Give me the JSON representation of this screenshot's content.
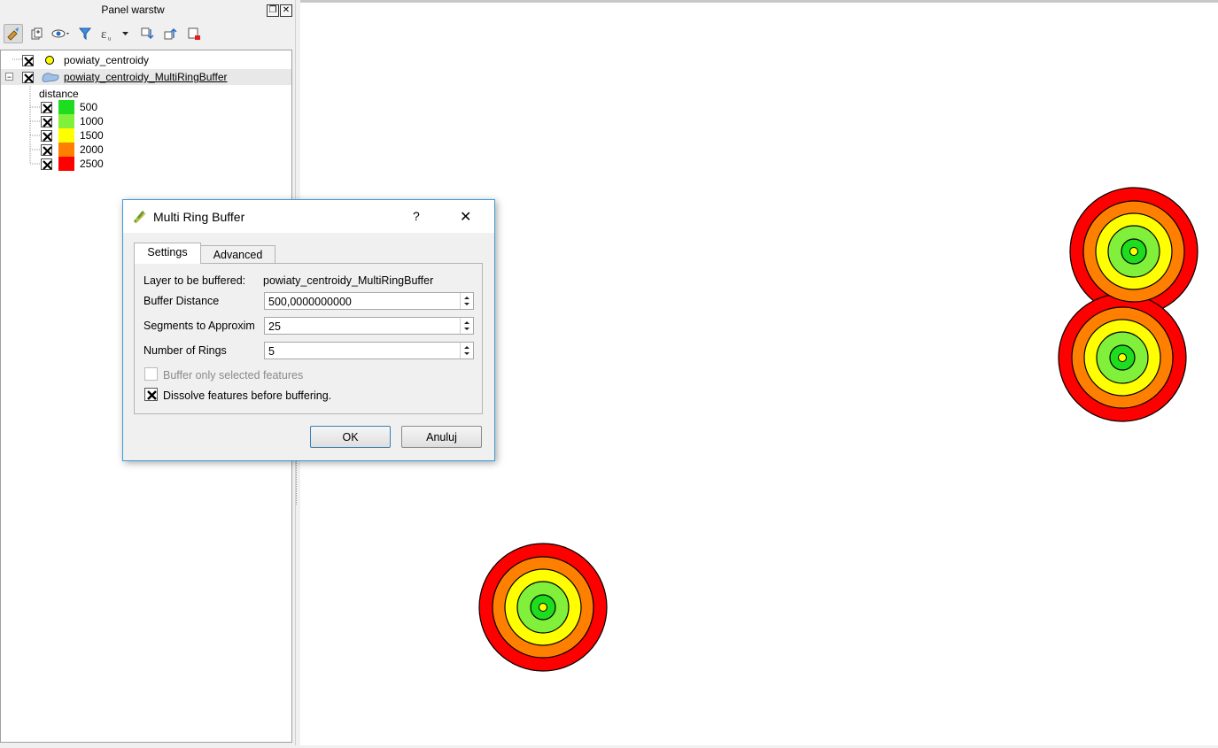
{
  "layers_panel": {
    "title": "Panel warstw",
    "float_button": "❐",
    "close_button": "✕",
    "toolbar": [
      "style-manager-icon",
      "add-group-icon",
      "visibility-icon",
      "filter-icon",
      "expression-icon",
      "expand-all-icon",
      "collapse-all-icon",
      "remove-layer-icon"
    ]
  },
  "layer_tree": {
    "layers": [
      {
        "name": "powiaty_centroidy",
        "checked": true,
        "symbol": "point",
        "symbol_color": "#ffff00"
      },
      {
        "name": "powiaty_centroidy_MultiRingBuffer",
        "checked": true,
        "symbol": "polygon",
        "symbol_color": "#9fc1e6",
        "expanded_marker": "−"
      }
    ],
    "legend_field": "distance",
    "classes": [
      {
        "label": "500",
        "color": "#1edc1e"
      },
      {
        "label": "1000",
        "color": "#80f03a"
      },
      {
        "label": "1500",
        "color": "#ffff00"
      },
      {
        "label": "2000",
        "color": "#ff8000"
      },
      {
        "label": "2500",
        "color": "#ff0000"
      }
    ]
  },
  "dialog": {
    "title": "Multi Ring Buffer",
    "help": "?",
    "close": "✕",
    "tabs": [
      "Settings",
      "Advanced"
    ],
    "active_tab": "Settings",
    "layer_label": "Layer to be buffered:",
    "layer_value": "powiaty_centroidy_MultiRingBuffer",
    "buffer_distance_label": "Buffer Distance",
    "buffer_distance_value": "500,0000000000",
    "segments_label": "Segments to Approxim",
    "segments_value": "25",
    "rings_label": "Number of Rings",
    "rings_value": "5",
    "selected_only_label": "Buffer only selected features",
    "selected_only_checked": false,
    "dissolve_label": "Dissolve features before buffering.",
    "dissolve_checked": true,
    "ok": "OK",
    "cancel": "Anuluj"
  },
  "colors": {
    "ring_500": "#1edc1e",
    "ring_1000": "#80f03a",
    "ring_1500": "#ffff00",
    "ring_2000": "#ff8000",
    "ring_2500": "#ff0000",
    "centroid": "#ffff00",
    "dialog_border": "#3c9ed8"
  }
}
